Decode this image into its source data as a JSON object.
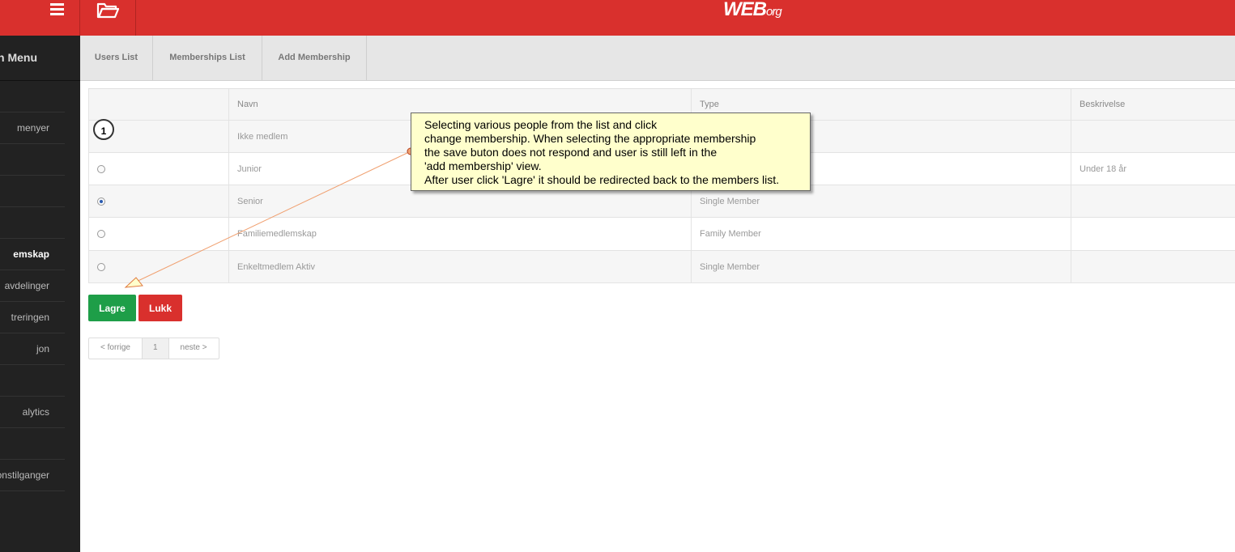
{
  "header": {
    "logo_main": "WEB",
    "logo_small": "org"
  },
  "sidebar": {
    "title": "n Menu",
    "items": [
      {
        "label": ""
      },
      {
        "label": "menyer"
      },
      {
        "label": ""
      },
      {
        "label": ""
      },
      {
        "label": ""
      },
      {
        "label": "emskap",
        "active": true
      },
      {
        "label": "avdelinger"
      },
      {
        "label": "treringen"
      },
      {
        "label": "jon"
      },
      {
        "label": ""
      },
      {
        "label": "alytics"
      },
      {
        "label": ""
      },
      {
        "label": "sjonstilganger"
      }
    ]
  },
  "tabs": [
    {
      "label": "Users List"
    },
    {
      "label": "Memberships List"
    },
    {
      "label": "Add Membership"
    }
  ],
  "table": {
    "headers": [
      "",
      "Navn",
      "Type",
      "Beskrivelse"
    ],
    "rows": [
      {
        "name": "Ikke medlem",
        "type": "",
        "desc": "",
        "radio": false,
        "checked": false
      },
      {
        "name": "Junior",
        "type": "",
        "desc": "Under 18 år",
        "radio": true,
        "checked": false
      },
      {
        "name": "Senior",
        "type": "Single Member",
        "desc": "",
        "radio": true,
        "checked": true
      },
      {
        "name": "Familiemedlemskap",
        "type": "Family Member",
        "desc": "",
        "radio": true,
        "checked": false
      },
      {
        "name": "Enkeltmedlem Aktiv",
        "type": "Single Member",
        "desc": "",
        "radio": true,
        "checked": false
      }
    ]
  },
  "buttons": {
    "save": "Lagre",
    "close": "Lukk"
  },
  "pagination": {
    "prev": "< forrige",
    "current": "1",
    "next": "neste >"
  },
  "annotation": {
    "step": "1",
    "lines": [
      "Selecting various people from the list and click",
      "change membership. When selecting the appropriate membership",
      "the save buton does not respond and user is still left in the",
      "'add membership' view.",
      "After user click 'Lagre' it should be redirected back to the members list."
    ]
  },
  "colors": {
    "brand": "#d9302d",
    "save": "#1e9e48",
    "sidebar": "#222222",
    "note": "#ffffcc"
  }
}
